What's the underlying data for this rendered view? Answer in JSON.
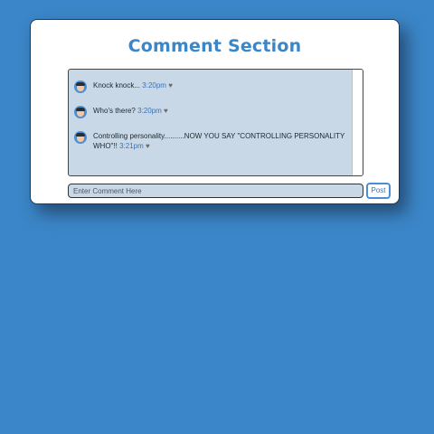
{
  "title": "Comment Section",
  "comments": [
    {
      "text": "Knock knock...",
      "time": "3:20pm",
      "like_icon": "heart-icon"
    },
    {
      "text": "Who's there?",
      "time": "3:20pm",
      "like_icon": "heart-icon"
    },
    {
      "text": "Controlling personality..........NOW YOU SAY \"CONTROLLING PERSONALITY WHO\"!!",
      "time": "3:21pm",
      "like_icon": "heart-icon"
    }
  ],
  "input": {
    "placeholder": "Enter Comment Here",
    "value": ""
  },
  "post_label": "Post",
  "colors": {
    "background": "#3b86c8",
    "accent": "#3b86c8",
    "comment_box": "#c8d8e6",
    "time_text": "#3b72bb"
  }
}
